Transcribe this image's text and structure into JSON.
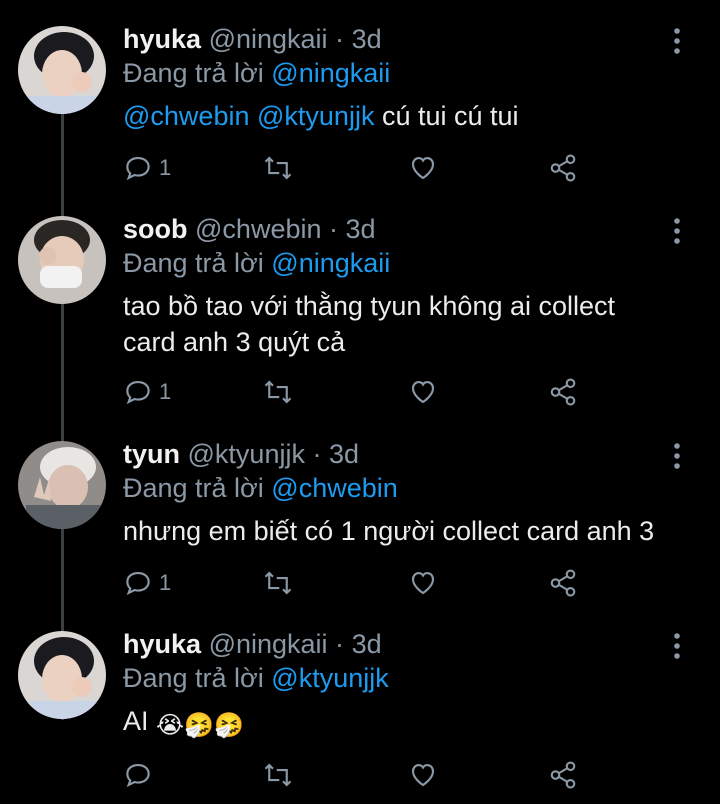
{
  "reply_prefix": "Đang trả lời",
  "tweets": [
    {
      "name": "hyuka",
      "handle": "@ningkaii",
      "separator": "·",
      "time": "3d",
      "reply_to": "@ningkaii",
      "text_mentions": [
        "@chwebin",
        "@ktyunjjk"
      ],
      "text_rest": " cú tui cú tui",
      "reply_count": "1"
    },
    {
      "name": "soob",
      "handle": "@chwebin",
      "separator": "·",
      "time": "3d",
      "reply_to": "@ningkaii",
      "text_lines": [
        "tao bồ tao với thằng tyun không ai collect",
        "card anh 3 quýt cả"
      ],
      "reply_count": "1"
    },
    {
      "name": "tyun",
      "handle": "@ktyunjjk",
      "separator": "·",
      "time": "3d",
      "reply_to": "@chwebin",
      "text": "nhưng em biết có 1 người collect card anh 3",
      "reply_count": "1"
    },
    {
      "name": "hyuka",
      "handle": "@ningkaii",
      "separator": "·",
      "time": "3d",
      "reply_to": "@ktyunjjk",
      "text": "AI",
      "emojis": "😭🤧🤧",
      "reply_count": ""
    }
  ],
  "colors": {
    "background": "#000000",
    "text": "#e7e9ea",
    "muted": "#8b98a5",
    "accent": "#1d9bf0"
  }
}
